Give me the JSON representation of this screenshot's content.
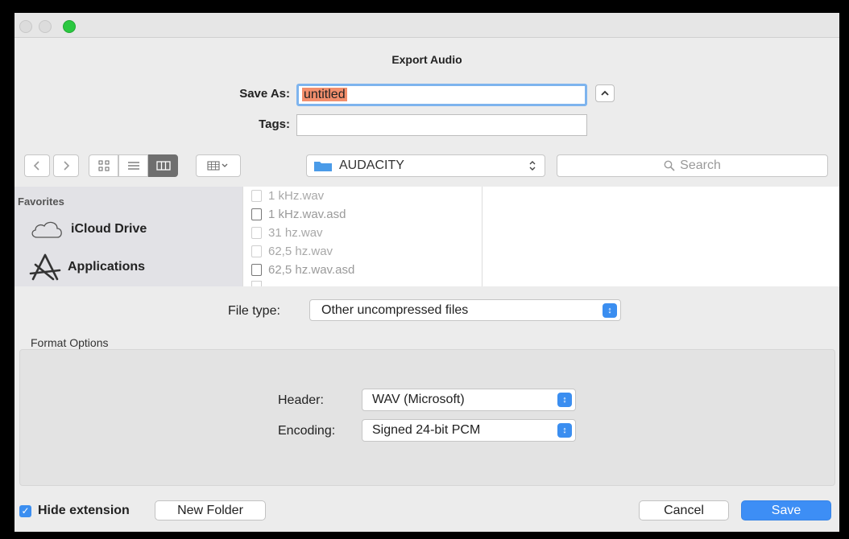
{
  "dialog": {
    "title": "Export Audio"
  },
  "save_as": {
    "label": "Save As:",
    "value": "untitled"
  },
  "tags": {
    "label": "Tags:",
    "value": ""
  },
  "toolbar": {
    "location": "AUDACITY",
    "search_placeholder": "Search"
  },
  "sidebar": {
    "section": "Favorites",
    "items": [
      {
        "label": "iCloud Drive",
        "icon": "cloud-icon"
      },
      {
        "label": "Applications",
        "icon": "applications-icon"
      }
    ]
  },
  "files": [
    {
      "name": "1 kHz.wav"
    },
    {
      "name": "1 kHz.wav.asd"
    },
    {
      "name": "31 hz.wav"
    },
    {
      "name": "62,5 hz.wav"
    },
    {
      "name": "62,5 hz.wav.asd"
    }
  ],
  "file_type": {
    "label": "File type:",
    "value": "Other uncompressed files"
  },
  "format_options": {
    "title": "Format Options",
    "header": {
      "label": "Header:",
      "value": "WAV (Microsoft)"
    },
    "encoding": {
      "label": "Encoding:",
      "value": "Signed 24-bit PCM"
    }
  },
  "footer": {
    "hide_extension": "Hide extension",
    "hide_extension_checked": true,
    "new_folder": "New Folder",
    "cancel": "Cancel",
    "save": "Save"
  },
  "colors": {
    "accent": "#3b8ef0",
    "selection": "#f28e6c",
    "focus_ring": "#7eb4ee"
  }
}
